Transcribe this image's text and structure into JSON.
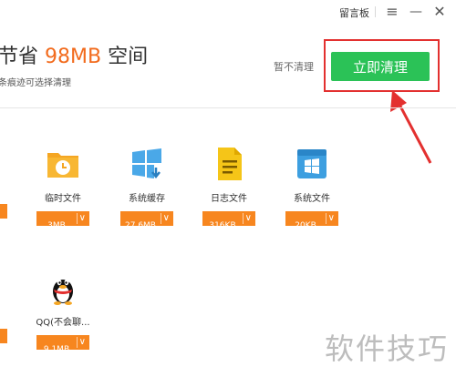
{
  "titlebar": {
    "feedback_label": "留言板",
    "menu_icon": "menu-icon",
    "minimize_icon": "minimize-icon",
    "close_icon": "close-icon"
  },
  "summary": {
    "prefix": "节省 ",
    "amount": "98MB",
    "suffix": " 空间",
    "subtext": "条痕迹可选择清理"
  },
  "actions": {
    "skip_label": "暂不清理",
    "clean_label": "立即清理"
  },
  "items": [
    {
      "label": "临时文件",
      "size": "3MB",
      "icon": "clock-folder-icon"
    },
    {
      "label": "系统缓存",
      "size": "27.6MB",
      "icon": "windows-cache-icon"
    },
    {
      "label": "日志文件",
      "size": "316KB",
      "icon": "log-file-icon"
    },
    {
      "label": "系统文件",
      "size": "20KB",
      "icon": "windows-file-icon"
    },
    {
      "label": "QQ(不会聊...",
      "size": "9.1MB",
      "icon": "qq-penguin-icon"
    }
  ],
  "watermark": "软件技巧",
  "colors": {
    "accent_orange": "#f7861f",
    "amount_orange": "#f26b1d",
    "clean_green": "#2bc257",
    "highlight_red": "#e3302f"
  }
}
